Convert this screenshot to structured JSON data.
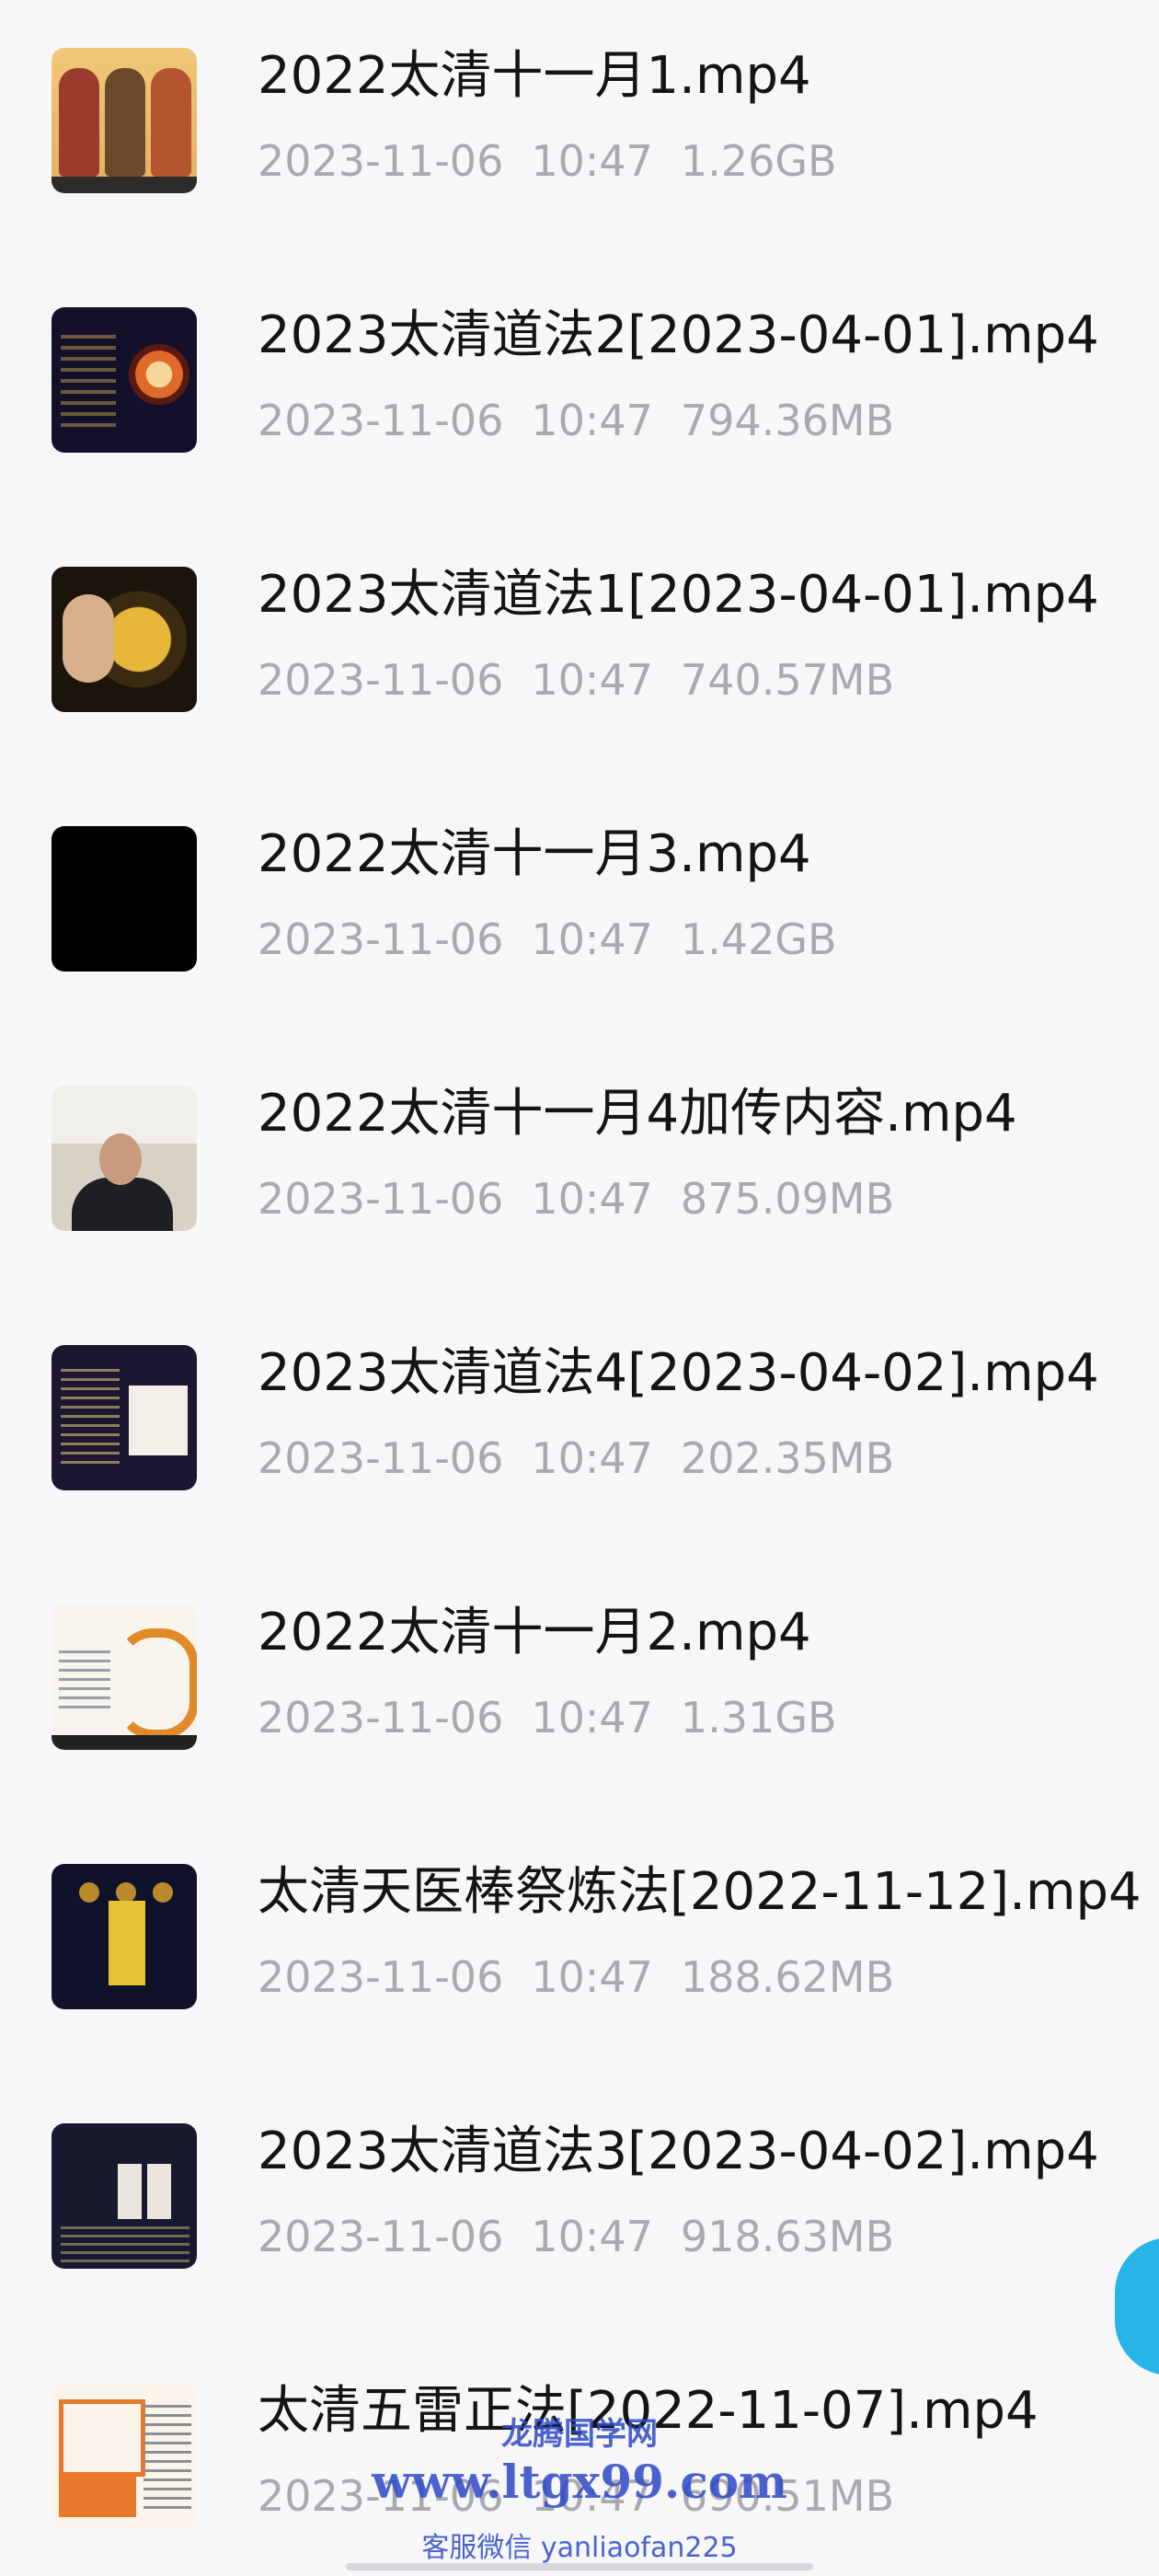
{
  "files": [
    {
      "name": "2022太清十一月1.mp4",
      "date": "2023-11-06",
      "time": "10:47",
      "size": "1.26GB",
      "thumb": "deities-video-thumbnail"
    },
    {
      "name": "2023太清道法2[2023-04-01].mp4",
      "date": "2023-11-06",
      "time": "10:47",
      "size": "794.36MB",
      "thumb": "dark-slide-video-thumbnail"
    },
    {
      "name": "2023太清道法1[2023-04-01].mp4",
      "date": "2023-11-06",
      "time": "10:47",
      "size": "740.57MB",
      "thumb": "hands-video-thumbnail"
    },
    {
      "name": "2022太清十一月3.mp4",
      "date": "2023-11-06",
      "time": "10:47",
      "size": "1.42GB",
      "thumb": "black-video-thumbnail"
    },
    {
      "name": "2022太清十一月4加传内容.mp4",
      "date": "2023-11-06",
      "time": "10:47",
      "size": "875.09MB",
      "thumb": "person-video-thumbnail"
    },
    {
      "name": "2023太清道法4[2023-04-02].mp4",
      "date": "2023-11-06",
      "time": "10:47",
      "size": "202.35MB",
      "thumb": "dark-text-video-thumbnail"
    },
    {
      "name": "2022太清十一月2.mp4",
      "date": "2023-11-06",
      "time": "10:47",
      "size": "1.31GB",
      "thumb": "dragon-video-thumbnail"
    },
    {
      "name": "太清天医棒祭炼法[2022-11-12].mp4",
      "date": "2023-11-06",
      "time": "10:47",
      "size": "188.62MB",
      "thumb": "talisman-video-thumbnail"
    },
    {
      "name": "2023太清道法3[2023-04-02].mp4",
      "date": "2023-11-06",
      "time": "10:47",
      "size": "918.63MB",
      "thumb": "cards-video-thumbnail"
    },
    {
      "name": "太清五雷正法[2022-11-07].mp4",
      "date": "2023-11-06",
      "time": "10:47",
      "size": "690.51MB",
      "thumb": "diagram-video-thumbnail"
    }
  ],
  "watermark": {
    "line1": "龙腾国学网",
    "line2": "www.ltgx99.com",
    "line3": "客服微信 yanliaofan225"
  },
  "colors": {
    "background": "#f7f7f9",
    "title": "#141414",
    "meta": "#a9a9ae",
    "fab": "#27b4ea",
    "watermark": "#2e49c7"
  }
}
